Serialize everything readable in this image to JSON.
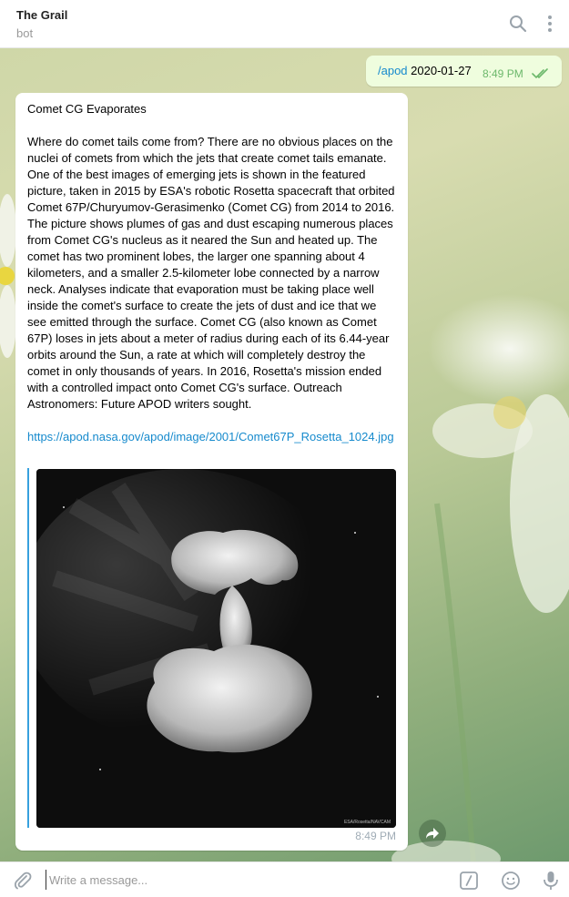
{
  "header": {
    "title": "The Grail",
    "subtitle": "bot"
  },
  "outgoing": {
    "command": "/apod",
    "argument": "2020-01-27",
    "time": "8:49 PM"
  },
  "incoming": {
    "title": "Comet CG Evaporates",
    "body": "Where do comet tails come from?  There are no obvious places on the nuclei of comets from which the jets that create comet tails emanate.  One of the best images of emerging jets is shown in the featured picture, taken in 2015 by ESA's robotic Rosetta spacecraft that orbited Comet 67P/Churyumov-Gerasimenko (Comet CG) from 2014 to 2016.  The picture shows plumes of gas and dust escaping numerous places from Comet CG's nucleus as it neared the Sun and heated up.  The comet has two prominent lobes, the larger one spanning about 4 kilometers, and a smaller 2.5-kilometer lobe connected by a narrow neck. Analyses indicate that evaporation must be taking place well inside the comet's surface to create the jets of dust and ice that we see emitted through the surface.  Comet CG (also known as Comet 67P) loses in jets about a meter of radius during each of its 6.44-year orbits around the Sun, a rate at which will completely destroy the comet in only thousands of years. In 2016, Rosetta's mission ended with a controlled impact onto Comet CG's surface.   Outreach Astronomers: Future APOD writers sought.",
    "link": "https://apod.nasa.gov/apod/image/2001/Comet67P_Rosetta_1024.jpg",
    "image_credit": "ESA/Rosetta/NAVCAM",
    "time": "8:49 PM"
  },
  "compose": {
    "placeholder": "Write a message..."
  },
  "icons": {
    "search": "search-icon",
    "more": "more-vertical-icon",
    "share": "share-arrow-icon",
    "attach": "paperclip-icon",
    "commands": "slash-command-icon",
    "emoji": "emoji-icon",
    "mic": "microphone-icon"
  },
  "colors": {
    "link": "#168acd",
    "outgoing_bubble": "#effdde",
    "read_ticks": "#6cb86b",
    "preview_bar": "#37a1de"
  }
}
